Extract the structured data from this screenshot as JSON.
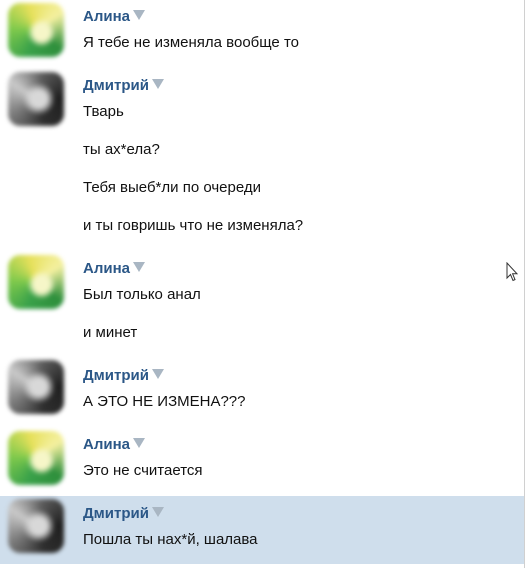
{
  "messages": [
    {
      "author": "Алина",
      "avatar": "alina-avatar",
      "lines": [
        "Я тебе не изменяла вообще то"
      ]
    },
    {
      "author": "Дмитрий",
      "avatar": "dmitry-avatar",
      "lines": [
        "Тварь",
        "ты ах*ела?",
        "Тебя выеб*ли по очереди",
        "и ты говришь что не изменяла?"
      ]
    },
    {
      "author": "Алина",
      "avatar": "alina-avatar",
      "lines": [
        "Был только анал",
        "и минет"
      ]
    },
    {
      "author": "Дмитрий",
      "avatar": "dmitry-avatar",
      "lines": [
        "А ЭТО НЕ ИЗМЕНА???"
      ]
    },
    {
      "author": "Алина",
      "avatar": "alina-avatar",
      "lines": [
        "Это не считается"
      ]
    },
    {
      "author": "Дмитрий",
      "avatar": "dmitry-avatar",
      "lines": [
        "Пошла ты нах*й, шалава"
      ],
      "highlighted": true
    }
  ],
  "icons": {
    "author_menu": "chevron-down-icon",
    "cursor": "mouse-cursor-icon"
  },
  "colors": {
    "author_name": "#2b5787",
    "highlight_row": "#cfdeec",
    "text": "#111111"
  }
}
